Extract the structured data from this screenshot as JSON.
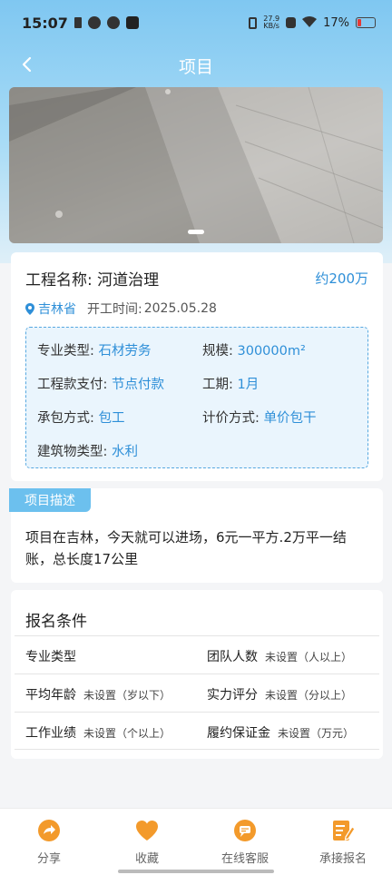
{
  "status_bar": {
    "time": "15:07",
    "net_speed_value": "27.9",
    "net_speed_unit": "KB/s",
    "battery": "17%",
    "battery_level": 0.17
  },
  "nav": {
    "title": "项目"
  },
  "banner": {
    "slide_count": 1,
    "active_slide": 0
  },
  "project": {
    "name_label": "工程名称:",
    "name": "河道治理",
    "price": "约200万",
    "location": "吉林省",
    "start_label": "开工时间:",
    "start_date": "2025.05.28",
    "details": [
      {
        "key": "专业类型:",
        "value": "石材劳务"
      },
      {
        "key": "规模:",
        "value": "300000m²"
      },
      {
        "key": "工程款支付:",
        "value": "节点付款"
      },
      {
        "key": "工期:",
        "value": "1月"
      },
      {
        "key": "承包方式:",
        "value": "包工"
      },
      {
        "key": "计价方式:",
        "value": "单价包干"
      },
      {
        "key": "建筑物类型:",
        "value": "水利"
      }
    ]
  },
  "description": {
    "tag": "项目描述",
    "text": "项目在吉林，今天就可以进场，6元一平方.2万平一结账，总长度17公里"
  },
  "conditions": {
    "title": "报名条件",
    "rows": [
      [
        {
          "key": "专业类型",
          "value": ""
        },
        {
          "key": "团队人数",
          "value": "未设置（人以上）"
        }
      ],
      [
        {
          "key": "平均年龄",
          "value": "未设置（岁以下）"
        },
        {
          "key": "实力评分",
          "value": "未设置（分以上）"
        }
      ],
      [
        {
          "key": "工作业绩",
          "value": "未设置（个以上）"
        },
        {
          "key": "履约保证金",
          "value": "未设置（万元）"
        }
      ]
    ]
  },
  "tab_bar": {
    "tabs": [
      {
        "label": "分享",
        "icon": "share-icon",
        "color": "#f39a2b"
      },
      {
        "label": "收藏",
        "icon": "heart-icon",
        "color": "#f39a2b"
      },
      {
        "label": "在线客服",
        "icon": "chat-icon",
        "color": "#f39a2b"
      },
      {
        "label": "承接报名",
        "icon": "edit-form-icon",
        "color": "#f39a2b"
      }
    ]
  },
  "colors": {
    "accent": "#2e8fd8",
    "header": "#7fc7f1",
    "tag": "#6cc0ee",
    "tab_icon": "#f39a2b"
  }
}
